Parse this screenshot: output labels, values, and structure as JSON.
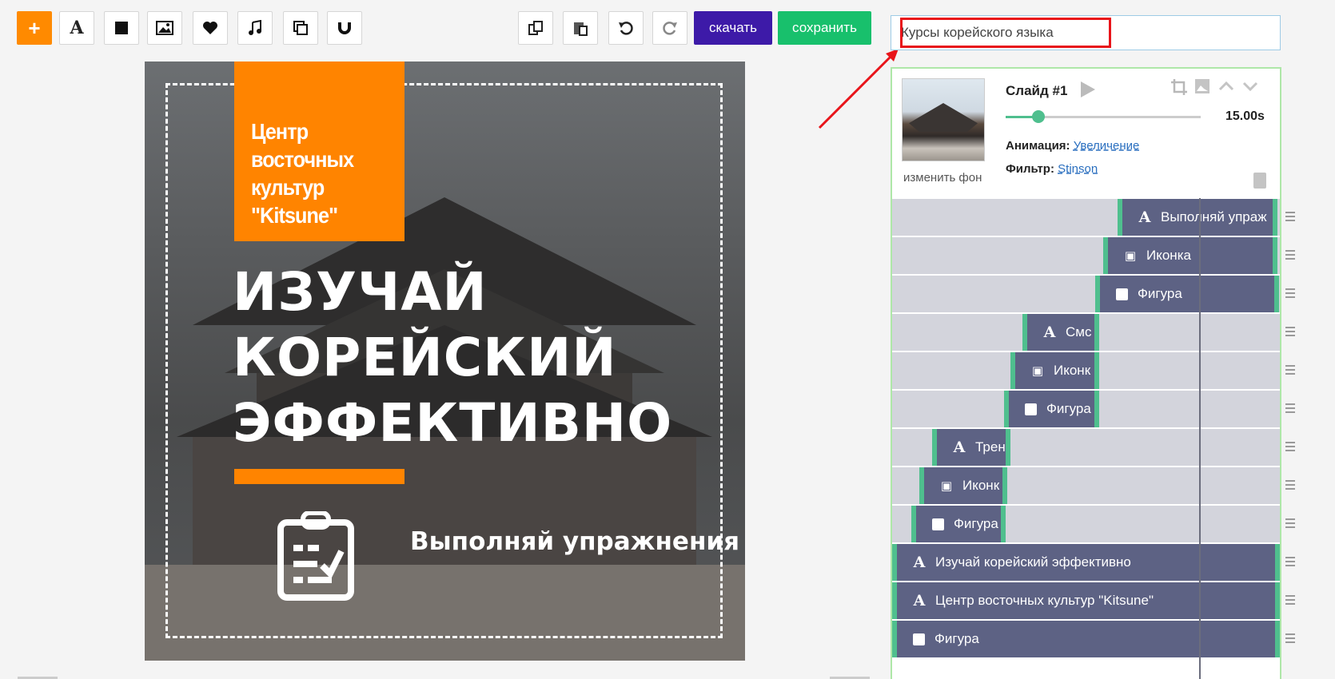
{
  "toolbar": {
    "add_label": "+",
    "text_label": "A",
    "download_label": "скачать",
    "save_label": "сохранить",
    "icons": [
      "plus-icon",
      "text-icon",
      "square-icon",
      "image-icon",
      "heart-icon",
      "music-icon",
      "duplicate-icon",
      "magnet-icon",
      "copy-icon",
      "paste-icon",
      "undo-icon",
      "redo-icon"
    ]
  },
  "canvas": {
    "badge_text": "Центр восточных культур \"Kitsune\"",
    "headline": "ИЗУЧАЙ КОРЕЙСКИЙ ЭФФЕКТИВНО",
    "caption": "Выполняй упражнения"
  },
  "project": {
    "title_value": "Курсы корейского языка"
  },
  "slide": {
    "title": "Слайд #1",
    "duration": "15.00s",
    "duration_fraction": 0.17,
    "change_bg_label": "изменить фон",
    "animation_label": "Анимация:",
    "animation_value": "Увеличение",
    "filter_label": "Фильтр:",
    "filter_value": "Stinson"
  },
  "layers": [
    {
      "type": "text",
      "label": "Выполняй упраж"
    },
    {
      "type": "icon",
      "label": "Иконка"
    },
    {
      "type": "shape",
      "label": "Фигура"
    },
    {
      "type": "text",
      "label": "Смс"
    },
    {
      "type": "icon",
      "label": "Иконк"
    },
    {
      "type": "shape",
      "label": "Фигура"
    },
    {
      "type": "text",
      "label": "Трен"
    },
    {
      "type": "icon",
      "label": "Иконк"
    },
    {
      "type": "shape",
      "label": "Фигура"
    },
    {
      "type": "text",
      "label": "Изучай корейский эффективно"
    },
    {
      "type": "text",
      "label": "Центр восточных культур \"Kitsune\""
    },
    {
      "type": "shape",
      "label": "Фигура"
    }
  ],
  "colors": {
    "accent_orange": "#ff8400",
    "download_purple": "#3d1aa8",
    "save_green": "#18c06c",
    "timeline_bar": "#5d6284",
    "timeline_edge": "#4fbf8e",
    "highlight_red": "#e8141a"
  }
}
